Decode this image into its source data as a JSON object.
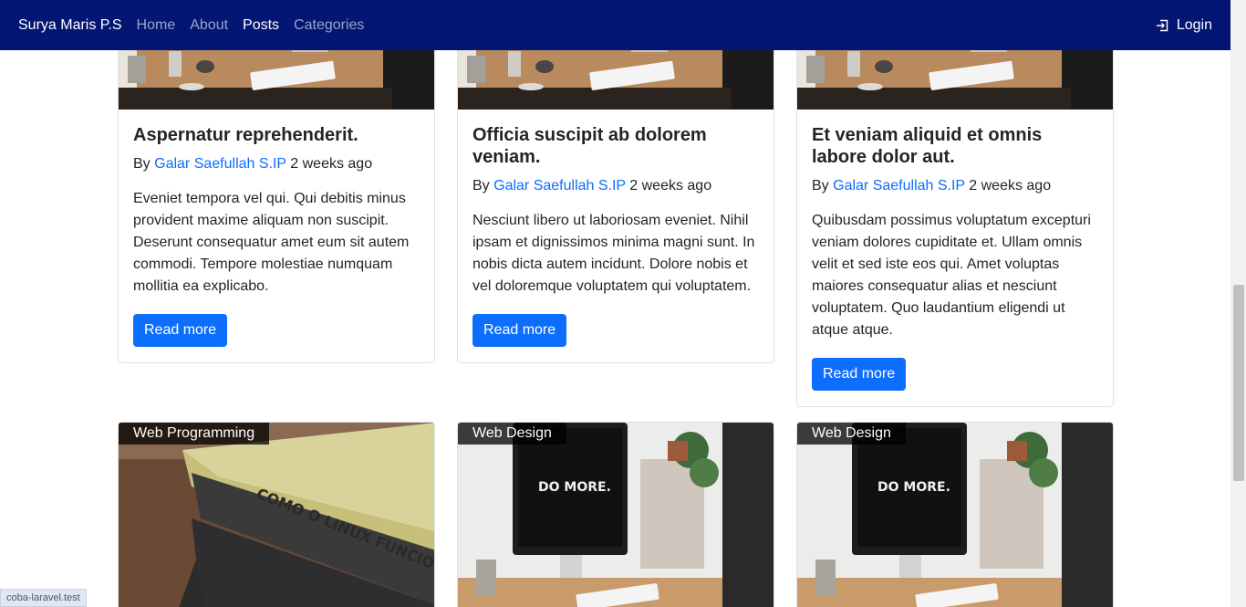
{
  "navbar": {
    "brand": "Surya Maris P.S",
    "links": [
      "Home",
      "About",
      "Posts",
      "Categories"
    ],
    "login": "Login"
  },
  "posts_top": [
    {
      "title": "Aspernatur reprehenderit.",
      "by": "By",
      "author": "Galar Saefullah S.IP",
      "time": "2 weeks ago",
      "excerpt": "Eveniet tempora vel qui. Qui debitis minus provident maxime aliquam non suscipit. Deserunt consequatur amet eum sit autem commodi. Tempore molestiae numquam mollitia ea explicabo.",
      "button": "Read more"
    },
    {
      "title": "Officia suscipit ab dolorem veniam.",
      "by": "By",
      "author": "Galar Saefullah S.IP",
      "time": "2 weeks ago",
      "excerpt": "Nesciunt libero ut laboriosam eveniet. Nihil ipsam et dignissimos minima magni sunt. In nobis dicta autem incidunt. Dolore nobis et vel doloremque voluptatem qui voluptatem.",
      "button": "Read more"
    },
    {
      "title": "Et veniam aliquid et omnis labore dolor aut.",
      "by": "By",
      "author": "Galar Saefullah S.IP",
      "time": "2 weeks ago",
      "excerpt": "Quibusdam possimus voluptatum excepturi veniam dolores cupiditate et. Ullam omnis velit et sed iste eos qui. Amet voluptas maiores consequatur alias et nesciunt voluptatem. Quo laudantium eligendi ut atque atque.",
      "button": "Read more"
    }
  ],
  "posts_bottom": [
    {
      "category": "Web Programming",
      "image_text": "COMO O LINUX FUNCIONA"
    },
    {
      "category": "Web Design",
      "image_text": "DO MORE."
    },
    {
      "category": "Web Design",
      "image_text": "DO MORE."
    }
  ],
  "status_url": "coba-laravel.test",
  "colors": {
    "navbar": "#031673",
    "primary": "#0d6efd",
    "link": "#0d6efd"
  }
}
